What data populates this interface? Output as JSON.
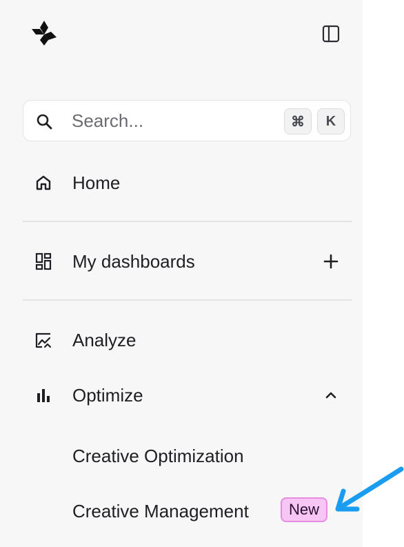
{
  "search": {
    "placeholder": "Search...",
    "shortcut_mod": "⌘",
    "shortcut_key": "K"
  },
  "nav": {
    "home": "Home",
    "dashboards": "My dashboards",
    "analyze": "Analyze",
    "optimize": "Optimize"
  },
  "optimize_children": [
    {
      "label": "Creative Optimization"
    },
    {
      "label": "Creative Management",
      "badge": "New"
    }
  ],
  "colors": {
    "badge_bg": "#f7c6f4",
    "badge_border": "#e58be0",
    "annotation_arrow": "#1a9cf0",
    "sidebar_bg": "#f7f7f8"
  },
  "icons": [
    "app-logo-icon",
    "sidebar-toggle-icon",
    "search-icon",
    "home-icon",
    "dashboard-grid-icon",
    "plus-icon",
    "analyze-chart-icon",
    "bar-chart-icon",
    "chevron-up-icon"
  ]
}
